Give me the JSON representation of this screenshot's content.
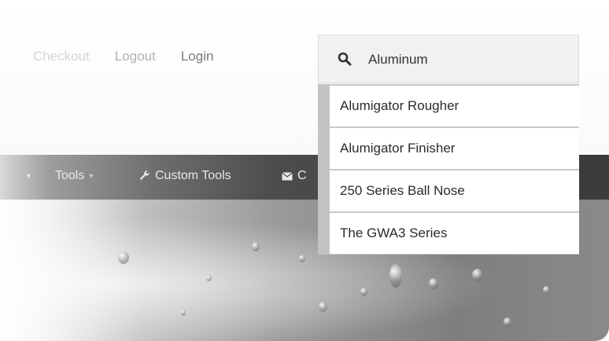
{
  "top_links": {
    "checkout": "Checkout",
    "logout": "Logout",
    "login": "Login"
  },
  "nav": {
    "tools_label": "Tools",
    "custom_tools_label": "Custom Tools",
    "contact_label_partial": "C"
  },
  "search": {
    "value": "Aluminum",
    "suggestions": [
      "Alumigator Rougher",
      "Alumigator Finisher",
      "250 Series Ball Nose",
      "The GWA3 Series"
    ]
  },
  "icons": {
    "search": "search-icon",
    "wrench": "wrench-icon",
    "envelope": "envelope-icon",
    "dropdown_caret": "caret-down-icon"
  }
}
